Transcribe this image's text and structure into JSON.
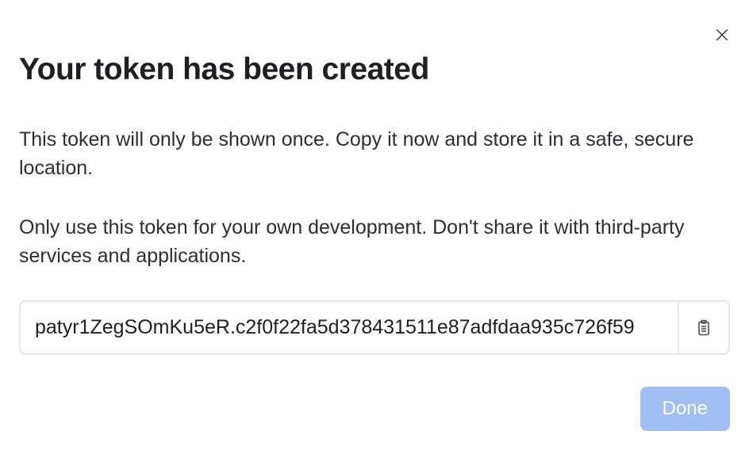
{
  "dialog": {
    "title": "Your token has been created",
    "description1": "This token will only be shown once. Copy it now and store it in a safe, secure location.",
    "description2": "Only use this token for your own development. Don't share it with third-party services and applications.",
    "token_value": "patyr1ZegSOmKu5eR.c2f0f22fa5d378431511e87adfdaa935c726f59",
    "done_label": "Done",
    "icons": {
      "close": "close-icon",
      "copy": "clipboard-icon"
    }
  }
}
